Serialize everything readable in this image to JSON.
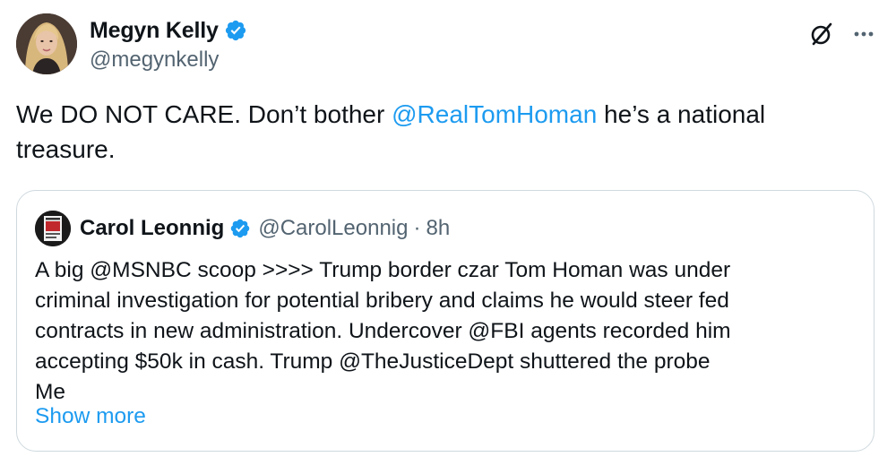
{
  "colors": {
    "link": "#1d9bf0",
    "text": "#0f1419",
    "secondary": "#536471",
    "border": "#cfd9de",
    "verified": "#1d9bf0"
  },
  "author": {
    "display_name": "Megyn Kelly",
    "handle": "@megynkelly",
    "verified_icon": "verified-badge-icon",
    "avatar_icon": "profile-photo"
  },
  "header_actions": {
    "grok_icon": "grok-icon",
    "more_icon": "more-horizontal-icon"
  },
  "tweet": {
    "text_before": "We DO NOT CARE. Don’t bother ",
    "mention": "@RealTomHoman",
    "text_after": " he’s a national treasure."
  },
  "quote": {
    "display_name": "Carol Leonnig",
    "handle": "@CarolLeonnig",
    "separator": "·",
    "time": "8h",
    "lines": [
      "A big @MSNBC scoop >>>>  Trump border czar Tom Homan was under",
      "criminal investigation for potential bribery and claims he would steer fed",
      "contracts in new administration.  Undercover @FBI agents recorded him",
      "accepting $50k in cash. Trump @TheJusticeDept shuttered the probe",
      "Me"
    ],
    "show_more": "Show more"
  }
}
